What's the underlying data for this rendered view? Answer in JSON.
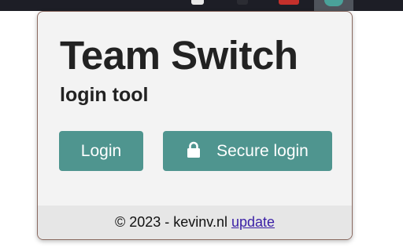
{
  "popup": {
    "title": "Team Switch",
    "subtitle": "login tool",
    "buttons": {
      "login_label": "Login",
      "secure_login_label": "Secure login",
      "secure_login_icon": "lock-icon"
    },
    "footer": {
      "copyright_text": "© 2023 - kevinv.nl",
      "update_link": "update"
    }
  },
  "colors": {
    "accent": "#4f958f",
    "popup_background": "#f3f3f3",
    "footer_background": "#e6e6e6",
    "browser_bar": "#1d1e26"
  }
}
